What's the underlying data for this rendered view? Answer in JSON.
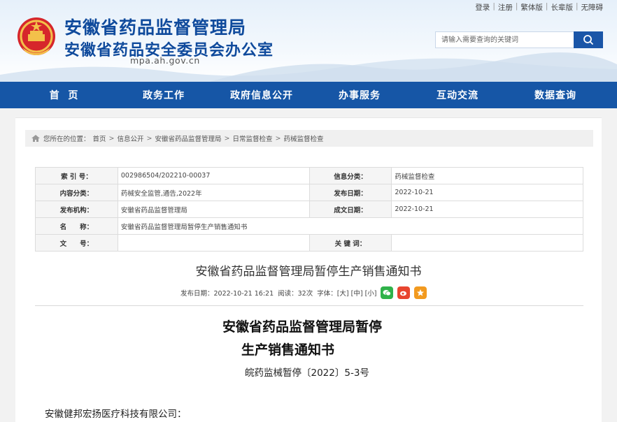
{
  "header": {
    "title_line1": "安徽省药品监督管理局",
    "title_line2": "安徽省药品安全委员会办公室",
    "domain": "mpa.ah.gov.cn",
    "toplinks": [
      "登录",
      "注册",
      "繁体版",
      "长辈版",
      "无障碍"
    ],
    "search_placeholder": "请输入需要查询的关键词",
    "brand_color": "#1656a6"
  },
  "nav": {
    "items": [
      "首 页",
      "政务工作",
      "政府信息公开",
      "办事服务",
      "互动交流",
      "数据查询"
    ]
  },
  "breadcrumb": {
    "prefix": "您所在的位置：",
    "items": [
      "首页",
      "信息公开",
      "安徽省药品监督管理局",
      "日常监督检查",
      "药械监督检查"
    ]
  },
  "meta": {
    "rows": [
      {
        "l1": "索 引 号：",
        "v1": "002986504/202210-00037",
        "l2": "信息分类：",
        "v2": "药械监督检查"
      },
      {
        "l1": "内容分类：",
        "v1": "药械安全监管,通告,2022年",
        "l2": "发布日期：",
        "v2": "2022-10-21"
      },
      {
        "l1": "发布机构：",
        "v1": "安徽省药品监督管理局",
        "l2": "成文日期：",
        "v2": "2022-10-21"
      },
      {
        "l1": "名　　称：",
        "v1": "安徽省药品监督管理局暂停生产销售通知书"
      },
      {
        "l1": "文　　号：",
        "v1": "",
        "l2": "关 键 词：",
        "v2": ""
      }
    ]
  },
  "article": {
    "title": "安徽省药品监督管理局暂停生产销售通知书",
    "publish": "发布日期：2022-10-21 16:21",
    "views": "阅读：32次",
    "font_size": "字体：[大] [中] [小]",
    "share_icons": [
      "wechat-icon",
      "weibo-icon",
      "favorite-icon"
    ],
    "doc_heading_1": "安徽省药品监督管理局暂停",
    "doc_heading_2": "生产销售通知书",
    "doc_number": "皖药监械暂停〔2022〕5-3号",
    "addressee": "安徽健邦宏扬医疗科技有限公司："
  }
}
